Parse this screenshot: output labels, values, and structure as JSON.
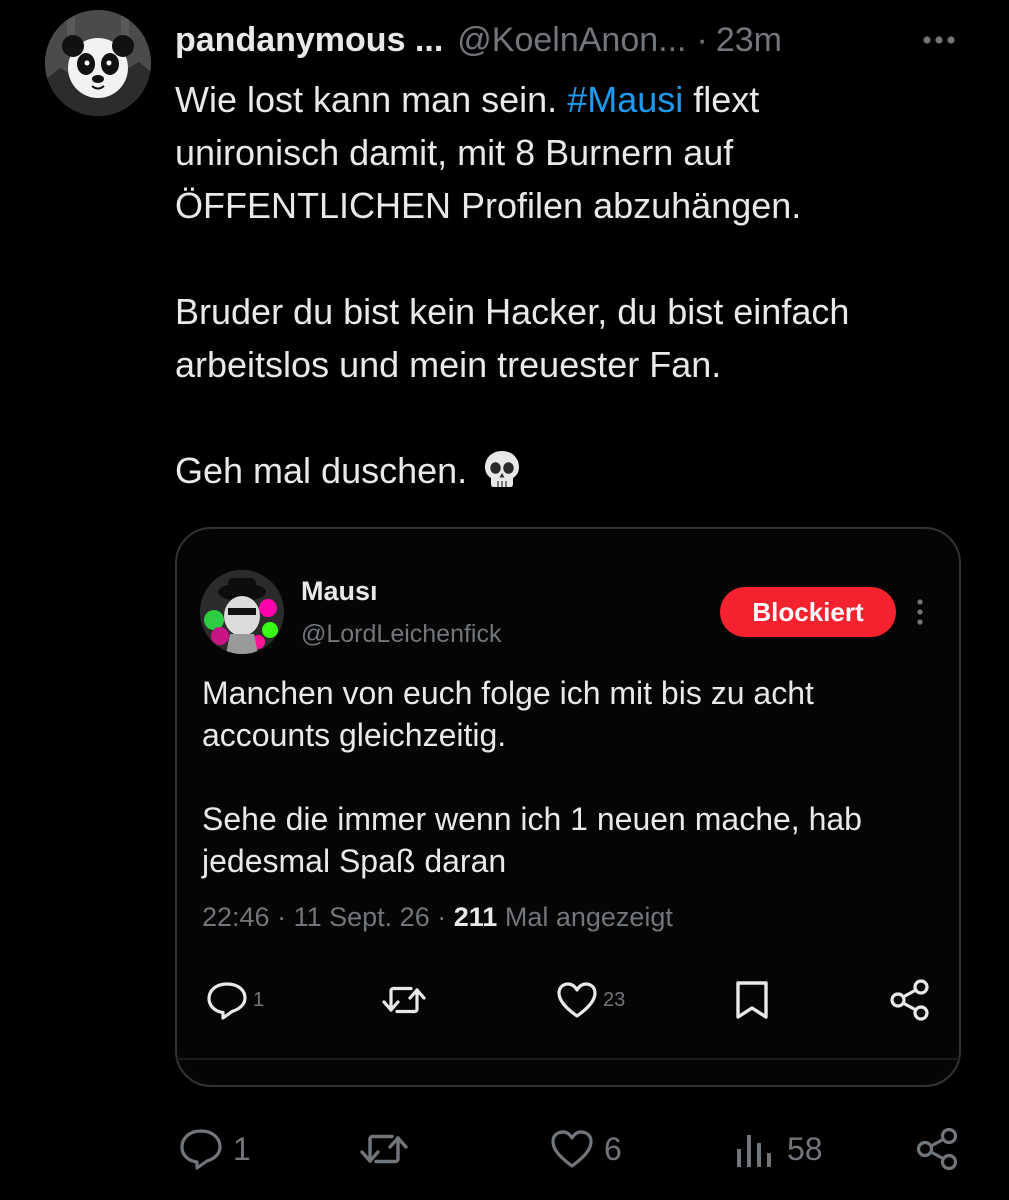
{
  "colors": {
    "background": "#000000",
    "text": "#e7e9ea",
    "muted": "#71767b",
    "link": "#1d9bf0",
    "blocked": "#f4212e"
  },
  "post": {
    "display_name": "pandanymous ...",
    "handle": "@KoelnAnon...",
    "separator": "·",
    "time": "23m",
    "more_icon": "more-horizontal-icon",
    "text_line1_before": "Wie lost kann man sein.",
    "hashtag": "#Mausi",
    "text_line1_after": "flext",
    "text_line2": "unironisch damit, mit 8 Burnern auf",
    "text_line3": "ÖFFENTLICHEN Profilen abzuhängen.",
    "text_line4": "Bruder du bist kein Hacker, du bist einfach",
    "text_line5": "arbeitslos und mein treuester Fan.",
    "text_line6": "Geh mal duschen.",
    "emoji": "skull-emoji"
  },
  "quote": {
    "display_name": "Mausı",
    "handle": "@LordLeichenfick",
    "blocked_label": "Blockiert",
    "menu_icon": "more-vertical-icon",
    "text_line1": "Manchen von euch folge ich mit bis zu acht",
    "text_line2": "accounts gleichzeitig.",
    "text_line3": "Sehe die immer wenn ich 1 neuen mache, hab",
    "text_line4": "jedesmal Spaß daran",
    "meta_time": "22:46",
    "meta_sep": "·",
    "meta_date": "11 Sept. 26",
    "meta_views": "211",
    "meta_views_label": "Mal angezeigt",
    "actions": {
      "reply_icon": "reply-icon",
      "reply_count": "1",
      "retweet_icon": "retweet-icon",
      "like_icon": "heart-icon",
      "like_count": "23",
      "bookmark_icon": "bookmark-icon",
      "share_icon": "share-icon"
    }
  },
  "actions": {
    "reply_icon": "reply-icon",
    "reply_count": "1",
    "retweet_icon": "retweet-icon",
    "like_icon": "heart-icon",
    "like_count": "6",
    "views_icon": "views-icon",
    "views_count": "58",
    "share_icon": "share-icon"
  }
}
